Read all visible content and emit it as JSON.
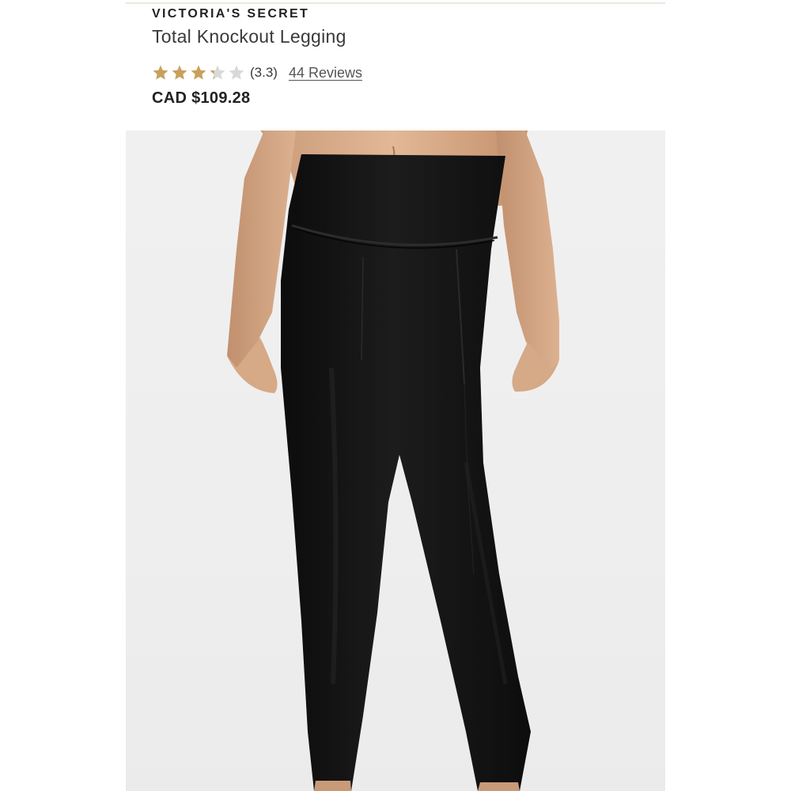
{
  "product": {
    "brand": "VICTORIA'S SECRET",
    "name": "Total Knockout Legging",
    "rating": {
      "value": 3.3,
      "max": 5,
      "display": "(3.3)",
      "reviews_label": "44 Reviews",
      "star_color": "#c9a05b",
      "empty_star_color": "#d9d9d9"
    },
    "price": "CAD $109.28"
  },
  "image": {
    "subject": "product-photo-black-leggings",
    "legging_color": "#111111",
    "background_color": "#efefef"
  }
}
